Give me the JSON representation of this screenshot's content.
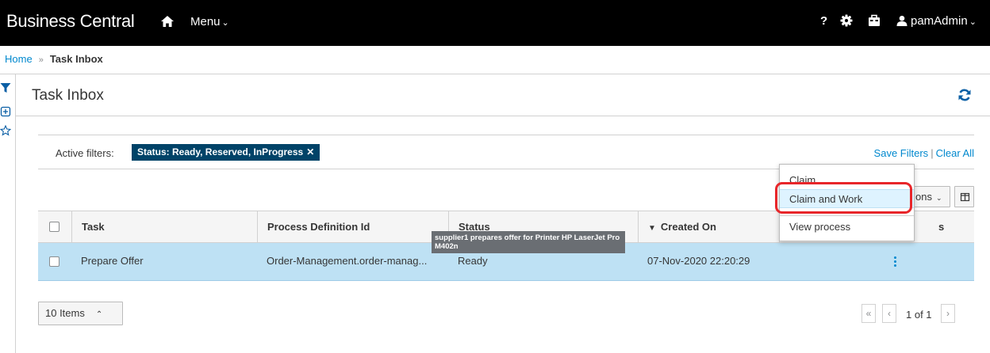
{
  "app": {
    "brand": "Business Central",
    "menu_label": "Menu",
    "help_label": "?",
    "user_label": "pamAdmin"
  },
  "breadcrumb": {
    "home": "Home",
    "separator": "»",
    "current": "Task Inbox"
  },
  "page": {
    "title": "Task Inbox"
  },
  "filters": {
    "label": "Active filters:",
    "chip": "Status: Ready, Reserved, InProgress",
    "chip_close": "✕",
    "save_label": "Save Filters",
    "separator": "|",
    "clear_label": "Clear All"
  },
  "toolbar": {
    "actions_partial": "ons"
  },
  "table": {
    "columns": [
      "Task",
      "Process Definition Id",
      "Status",
      "Created On",
      "s"
    ],
    "sort_indicator": "▼",
    "rows": [
      {
        "task": "Prepare Offer",
        "process": "Order-Management.order-manag...",
        "status": "Ready",
        "created": "07-Nov-2020 22:20:29"
      }
    ]
  },
  "tooltip": {
    "text": "supplier1 prepares offer for Printer HP LaserJet Pro M402n"
  },
  "dropdown": {
    "items": [
      "Claim",
      "Claim and Work",
      "View process"
    ],
    "highlighted": "Claim and Work"
  },
  "pagination": {
    "items_label": "10 Items",
    "page_text": "1 of 1",
    "first": "«",
    "prev": "‹",
    "next": "›"
  },
  "colors": {
    "topbar": "#000000",
    "accent": "#0088ce",
    "chip": "#004368",
    "selected_row": "#bee1f4",
    "highlight_ring": "#e8262a"
  }
}
